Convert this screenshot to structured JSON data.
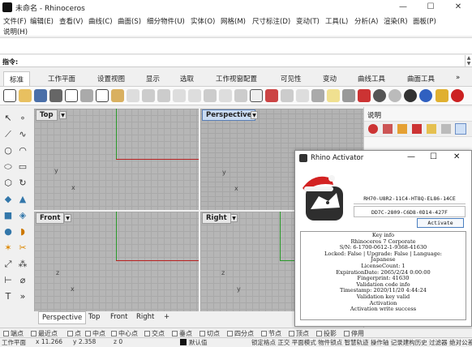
{
  "window": {
    "title": "未命名 - Rhinoceros",
    "minimize": "—",
    "maximize": "☐",
    "close": "✕"
  },
  "menu": [
    "文件(F)",
    "编辑(E)",
    "查看(V)",
    "曲线(C)",
    "曲面(S)",
    "细分物件(U)",
    "实体(O)",
    "网格(M)",
    "尺寸标注(D)",
    "变动(T)",
    "工具(L)",
    "分析(A)",
    "渲染(R)",
    "面板(P)",
    "说明(H)"
  ],
  "command": {
    "label": "指令:",
    "value": ""
  },
  "tabs": [
    "标准",
    "工作平面",
    "设置视图",
    "显示",
    "选取",
    "工作视窗配置",
    "可见性",
    "变动",
    "曲线工具",
    "曲面工具"
  ],
  "tabs_more": "»",
  "viewports": {
    "top": {
      "label": "Top",
      "xaxis": "x",
      "yaxis": "y"
    },
    "perspective": {
      "label": "Perspective",
      "xaxis": "x",
      "yaxis": "y"
    },
    "front": {
      "label": "Front",
      "xaxis": "x",
      "yaxis": "z"
    },
    "right": {
      "label": "Right",
      "xaxis": "y",
      "yaxis": "z"
    }
  },
  "viewport_tabs": [
    "Perspective",
    "Top",
    "Front",
    "Right"
  ],
  "viewport_tabs_add": "+",
  "right_panel": {
    "title": "说明"
  },
  "osnaps": [
    "端点",
    "最近点",
    "点",
    "中点",
    "中心点",
    "交点",
    "垂点",
    "切点",
    "四分点",
    "节点",
    "顶点",
    "投影",
    "停用"
  ],
  "status": {
    "plane": "工作平面",
    "x": "x 11.266",
    "y": "y 2.358",
    "z": "z 0",
    "layer": "默认值",
    "message": "锁定格点 正交 平面模式 物件锁点 智慧轨迹 操作轴 记录建构历史 过滤器 绝对公差: 0.001"
  },
  "activator": {
    "title": "Rhino Activator",
    "code1": "RH70-U8R2-11C4-HT8Q-EL86-14CE",
    "code2": "DD7C-2809-C6D8-0D14-427F",
    "activate_label": "Activate",
    "info": [
      "Key info",
      "Rhinoceros 7 Corporate",
      "S/N: 6-1700-0612-1-9368-41630",
      "Locked: False | Upgrade: False | Language:",
      "Japanese",
      "LicenseCount: 1",
      "ExpirationDate: 2065/2/24 0:00:00",
      "Fingerprint: 41630",
      "Validation code info",
      "Timestamp: 2020/11/20 4:44:24",
      "Validation key valid",
      "Activation",
      "Activation write success"
    ]
  }
}
